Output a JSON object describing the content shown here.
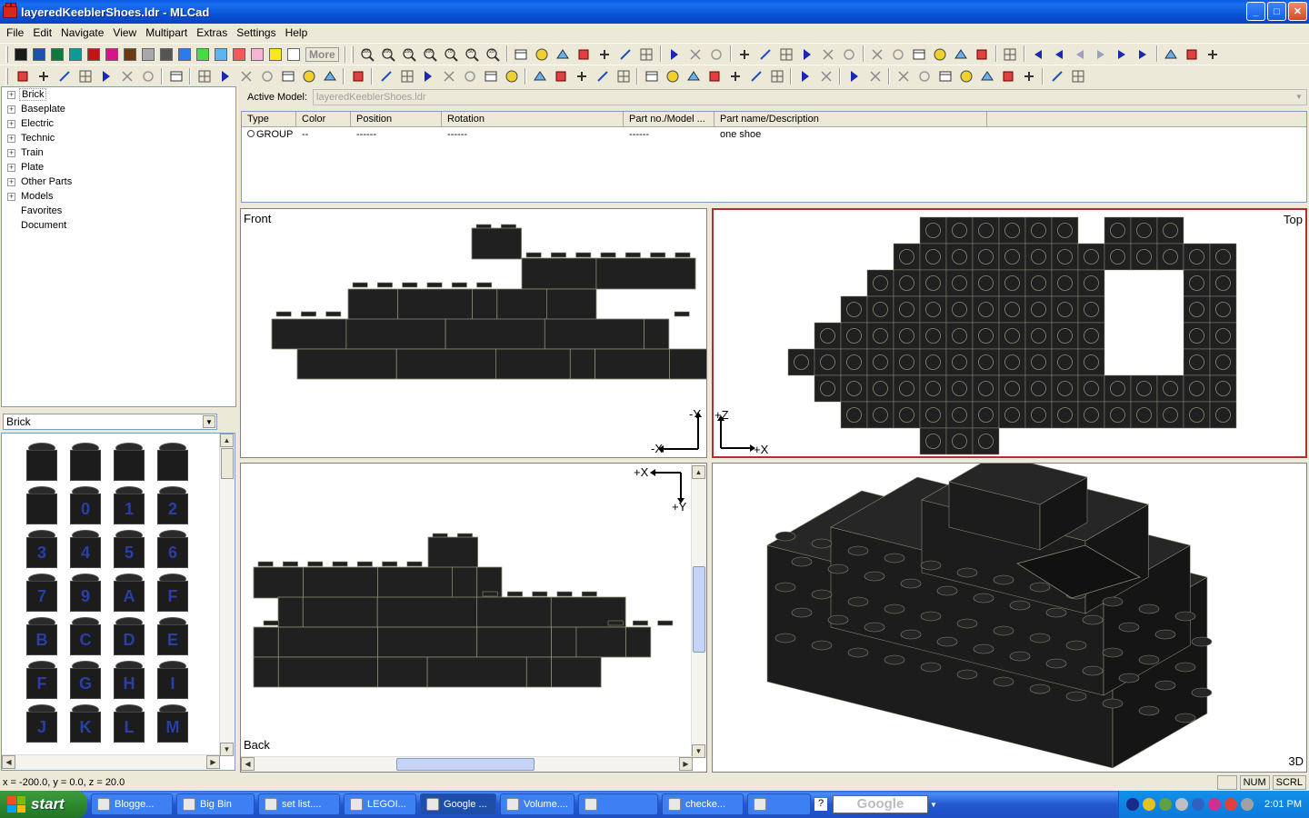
{
  "window": {
    "title": "layeredKeeblerShoes.ldr - MLCad"
  },
  "menu": [
    "File",
    "Edit",
    "Navigate",
    "View",
    "Multipart",
    "Extras",
    "Settings",
    "Help"
  ],
  "toolbar": {
    "colors": [
      "#1a1a1a",
      "#1c4fae",
      "#0f7a3a",
      "#0a9a9a",
      "#c4141a",
      "#d8148a",
      "#6a3a14",
      "#a8a8a8",
      "#555555",
      "#2a7af0",
      "#4ad84a",
      "#5ab4f0",
      "#f05a5a",
      "#f8b4d4",
      "#f8e81a",
      "#ffffff"
    ],
    "more_label": "More",
    "zoom_labels": [
      "300",
      "200",
      "150",
      "100",
      "75",
      "50",
      "25"
    ]
  },
  "tree": {
    "items": [
      {
        "label": "Brick",
        "expandable": true,
        "selected": true
      },
      {
        "label": "Baseplate",
        "expandable": true
      },
      {
        "label": "Electric",
        "expandable": true
      },
      {
        "label": "Technic",
        "expandable": true
      },
      {
        "label": "Train",
        "expandable": true
      },
      {
        "label": "Plate",
        "expandable": true
      },
      {
        "label": "Other Parts",
        "expandable": true
      },
      {
        "label": "Models",
        "expandable": true
      },
      {
        "label": "Favorites",
        "expandable": false
      },
      {
        "label": "Document",
        "expandable": false
      }
    ]
  },
  "parts": {
    "category": "Brick",
    "bricks": [
      "",
      "",
      "",
      "",
      "",
      "0",
      "1",
      "2",
      "3",
      "4",
      "5",
      "6",
      "7",
      "9",
      "A",
      "F",
      "B",
      "C",
      "D",
      "E",
      "F",
      "G",
      "H",
      "I",
      "J",
      "K",
      "L",
      "M"
    ]
  },
  "active_model": {
    "label": "Active Model:",
    "value": "layeredKeeblerShoes.ldr"
  },
  "list": {
    "columns": [
      "Type",
      "Color",
      "Position",
      "Rotation",
      "Part no./Model ...",
      "Part name/Description"
    ],
    "rows": [
      {
        "type": "GROUP",
        "color": "--",
        "position": "------",
        "rotation": "------",
        "part_no": "------",
        "description": "one shoe"
      }
    ]
  },
  "views": {
    "front": {
      "label": "Front",
      "axis_v": "-Y",
      "axis_h": "-X"
    },
    "top": {
      "label": "Top",
      "axis_v": "+Z",
      "axis_h": "+X"
    },
    "back": {
      "label": "Back",
      "axis_h": "+X",
      "axis_v": "+Y"
    },
    "threed": {
      "label": "3D"
    }
  },
  "status": {
    "coords": "x = -200.0, y = 0.0, z = 20.0",
    "num": "NUM",
    "scrl": "SCRL"
  },
  "taskbar": {
    "start": "start",
    "tasks": [
      "Blogge...",
      "Big Bin",
      "set list....",
      "LEGOI...",
      "Google ...",
      "Volume....",
      "",
      "checke...",
      ""
    ],
    "search_placeholder": "Google",
    "clock": "2:01 PM"
  }
}
